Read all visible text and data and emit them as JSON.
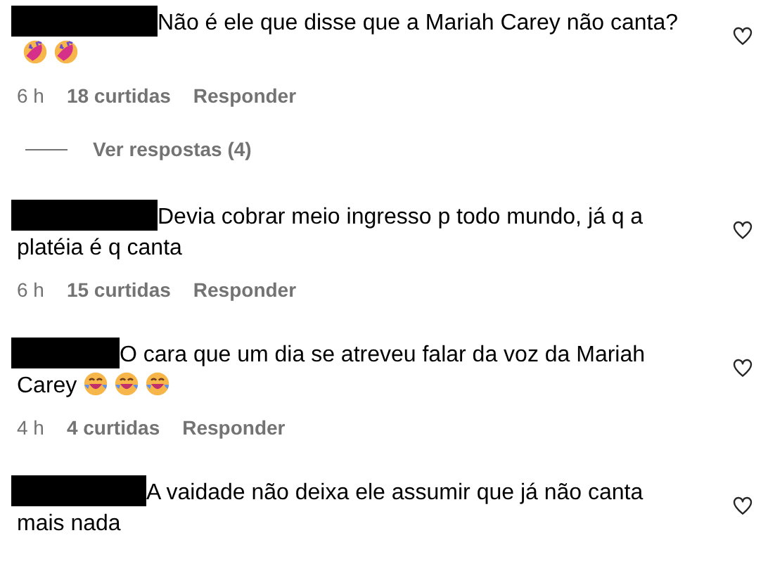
{
  "comments": [
    {
      "text": "Não é ele que disse que a Mariah Carey não canta?",
      "emojis": [
        {
          "kind": "rofl"
        },
        {
          "kind": "rofl"
        }
      ],
      "time": "6 h",
      "likes": "18 curtidas",
      "reply": "Responder",
      "view_replies": "Ver respostas (4)",
      "liked": false
    },
    {
      "text": "Devia cobrar meio ingresso p todo mundo, já q a platéia é q canta",
      "time": "6 h",
      "likes": "15 curtidas",
      "reply": "Responder",
      "liked": false
    },
    {
      "text": "O cara que um dia se atreveu falar da voz da Mariah Carey",
      "emojis": [
        {
          "kind": "joy"
        },
        {
          "kind": "joy"
        },
        {
          "kind": "joy"
        }
      ],
      "time": "4 h",
      "likes": "4 curtidas",
      "reply": "Responder",
      "liked": false
    },
    {
      "text": "A vaidade não deixa ele assumir que já não canta mais nada",
      "liked": false
    }
  ]
}
